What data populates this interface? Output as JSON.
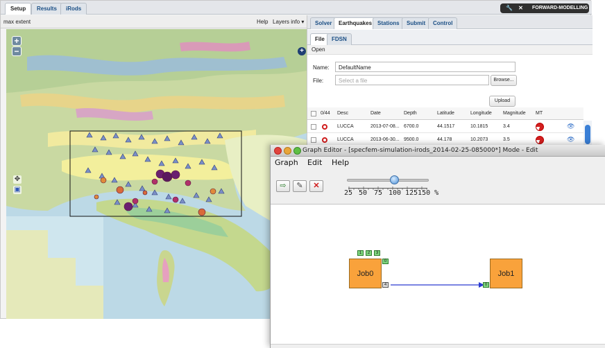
{
  "app": {
    "top_tabs": [
      "Setup",
      "Results",
      "iRods"
    ],
    "badge_icons": "🔧 ✕",
    "badge_label": "FORWARD-MODELLING",
    "map_toolbar": {
      "extent": "max extent",
      "help": "Help",
      "layers": "Layers info ▾"
    },
    "map_controls": {
      "zoom_in": "+",
      "zoom_out": "−",
      "pan": "✥",
      "select": "▣",
      "add_layer": "+"
    },
    "right_tabs": [
      "Solver",
      "Earthquakes",
      "Stations",
      "Submit",
      "Control"
    ],
    "sub_tabs": [
      "File",
      "FDSN"
    ],
    "open_label": "Open",
    "form": {
      "name_label": "Name:",
      "name_value": "DefaultName",
      "file_label": "File:",
      "file_placeholder": "Select a file",
      "browse": "Browse...",
      "upload": "Upload"
    },
    "table": {
      "columns": [
        "0/44",
        "Desc",
        "Date",
        "Depth",
        "Latitude",
        "Longitude",
        "Magnitude",
        "MT"
      ],
      "rows": [
        {
          "desc": "LUCCA",
          "date": "2013-07-08...",
          "depth": "6700.0",
          "lat": "44.1517",
          "lon": "10.1815",
          "mag": "3.4"
        },
        {
          "desc": "LUCCA",
          "date": "2013-06-30...",
          "depth": "9500.0",
          "lat": "44.178",
          "lon": "10.2073",
          "mag": "3.5"
        }
      ]
    }
  },
  "graph_editor": {
    "title": "Graph Editor - [specfem-simulation-irods_2014-02-25-085000*]  Mode - Edit",
    "menus": [
      "Graph",
      "Edit",
      "Help"
    ],
    "zoom_labels": [
      "25",
      "50",
      "75",
      "100",
      "125150 %"
    ],
    "zoom_value": 100,
    "jobs": [
      {
        "name": "Job0",
        "in_ports": [
          "1",
          "2",
          "3"
        ],
        "top_port": "0",
        "out_port": "4"
      },
      {
        "name": "Job1",
        "in_port": "0"
      }
    ]
  },
  "colors": {
    "accent": "#1b4f85",
    "job": "#f9a23b",
    "port": "#7fd67f",
    "edge": "#2a3bd1",
    "mt": "#d32020"
  }
}
